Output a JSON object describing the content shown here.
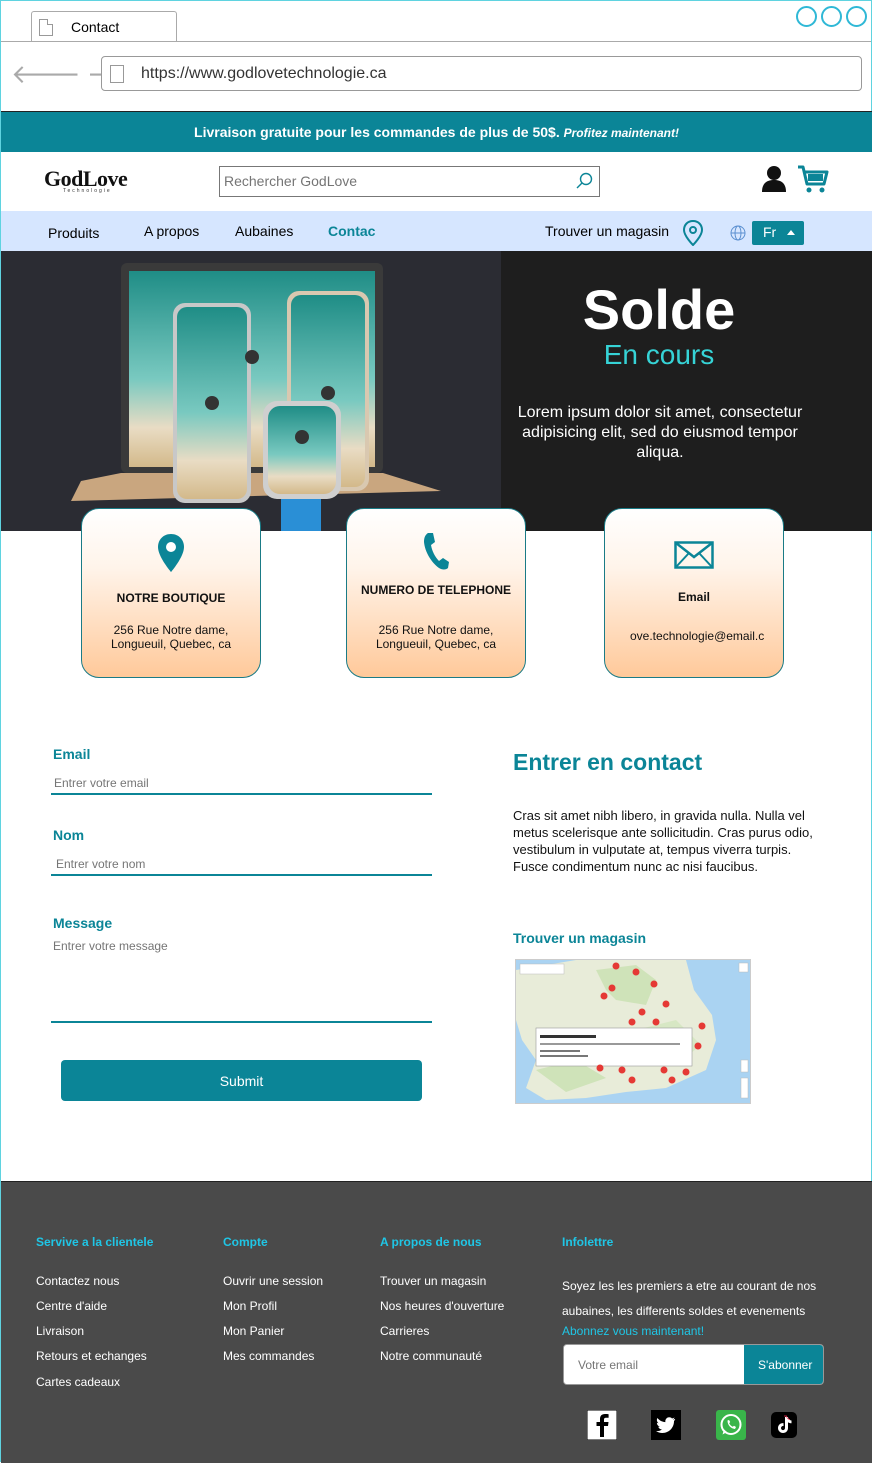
{
  "browser": {
    "tab_label": "Contact",
    "url": "https://www.godlovetechnologie.ca"
  },
  "promo": {
    "text": "Livraison gratuite pour les commandes de plus de 50$.",
    "cta": "Profitez maintenant!"
  },
  "header": {
    "logo": "GodLove",
    "logo_sub": "Technologie",
    "search_placeholder": "Rechercher GodLove"
  },
  "nav": {
    "items": [
      "Produits",
      "A propos",
      "Aubaines",
      "Contac"
    ],
    "store_finder": "Trouver un magasin",
    "language": "Fr"
  },
  "hero": {
    "title": "Solde",
    "subtitle": "En cours",
    "text": "Lorem ipsum dolor sit amet, consectetur adipisicing elit, sed do eiusmod tempor aliqua."
  },
  "cards": [
    {
      "title": "NOTRE BOUTIQUE",
      "text": "256 Rue Notre dame, Longueuil, Quebec, ca"
    },
    {
      "title": "NUMERO DE TELEPHONE",
      "text": "256 Rue Notre dame, Longueuil, Quebec, ca"
    },
    {
      "title": "Email",
      "text": "ove.technologie@email.c"
    }
  ],
  "form": {
    "email_label": "Email",
    "email_placeholder": "Entrer votre email",
    "name_label": "Nom",
    "name_placeholder": "Entrer votre nom",
    "message_label": "Message",
    "message_placeholder": "Entrer votre message",
    "submit": "Submit"
  },
  "contact": {
    "title": "Entrer en contact",
    "text": "Cras sit amet nibh libero, in gravida nulla. Nulla vel metus scelerisque ante sollicitudin. Cras purus odio, vestibulum in vulputate at, tempus viverra turpis. Fusce condimentum nunc ac nisi faucibus.",
    "store_title": "Trouver un magasin"
  },
  "footer": {
    "col1": {
      "head": "Servive a la clientele",
      "items": [
        "Contactez nous",
        "Centre d'aide",
        "Livraison",
        "Retours et echanges",
        "Cartes cadeaux"
      ]
    },
    "col2": {
      "head": "Compte",
      "items": [
        "Ouvrir une session",
        "Mon Profil",
        "Mon Panier",
        "Mes commandes"
      ]
    },
    "col3": {
      "head": "A propos de nous",
      "items": [
        "Trouver un magasin",
        "Nos heures d'ouverture",
        "Carrieres",
        "Notre communauté"
      ]
    },
    "col4": {
      "head": "Infolettre",
      "text": "Soyez les les premiers a etre au courant de nos aubaines, les differents soldes et evenements",
      "link": "Abonnez vous maintenant!",
      "email_placeholder": "Votre email",
      "subscribe": "S'abonner"
    },
    "social": [
      "facebook-icon",
      "twitter-icon",
      "whatsapp-icon",
      "tiktok-icon"
    ]
  },
  "colors": {
    "accent": "#0b8597",
    "nav_bg": "#d6e6ff",
    "footer_bg": "#4a4a4a",
    "footer_heading": "#1fc6e6",
    "hero_subtitle": "#36d3d6"
  }
}
